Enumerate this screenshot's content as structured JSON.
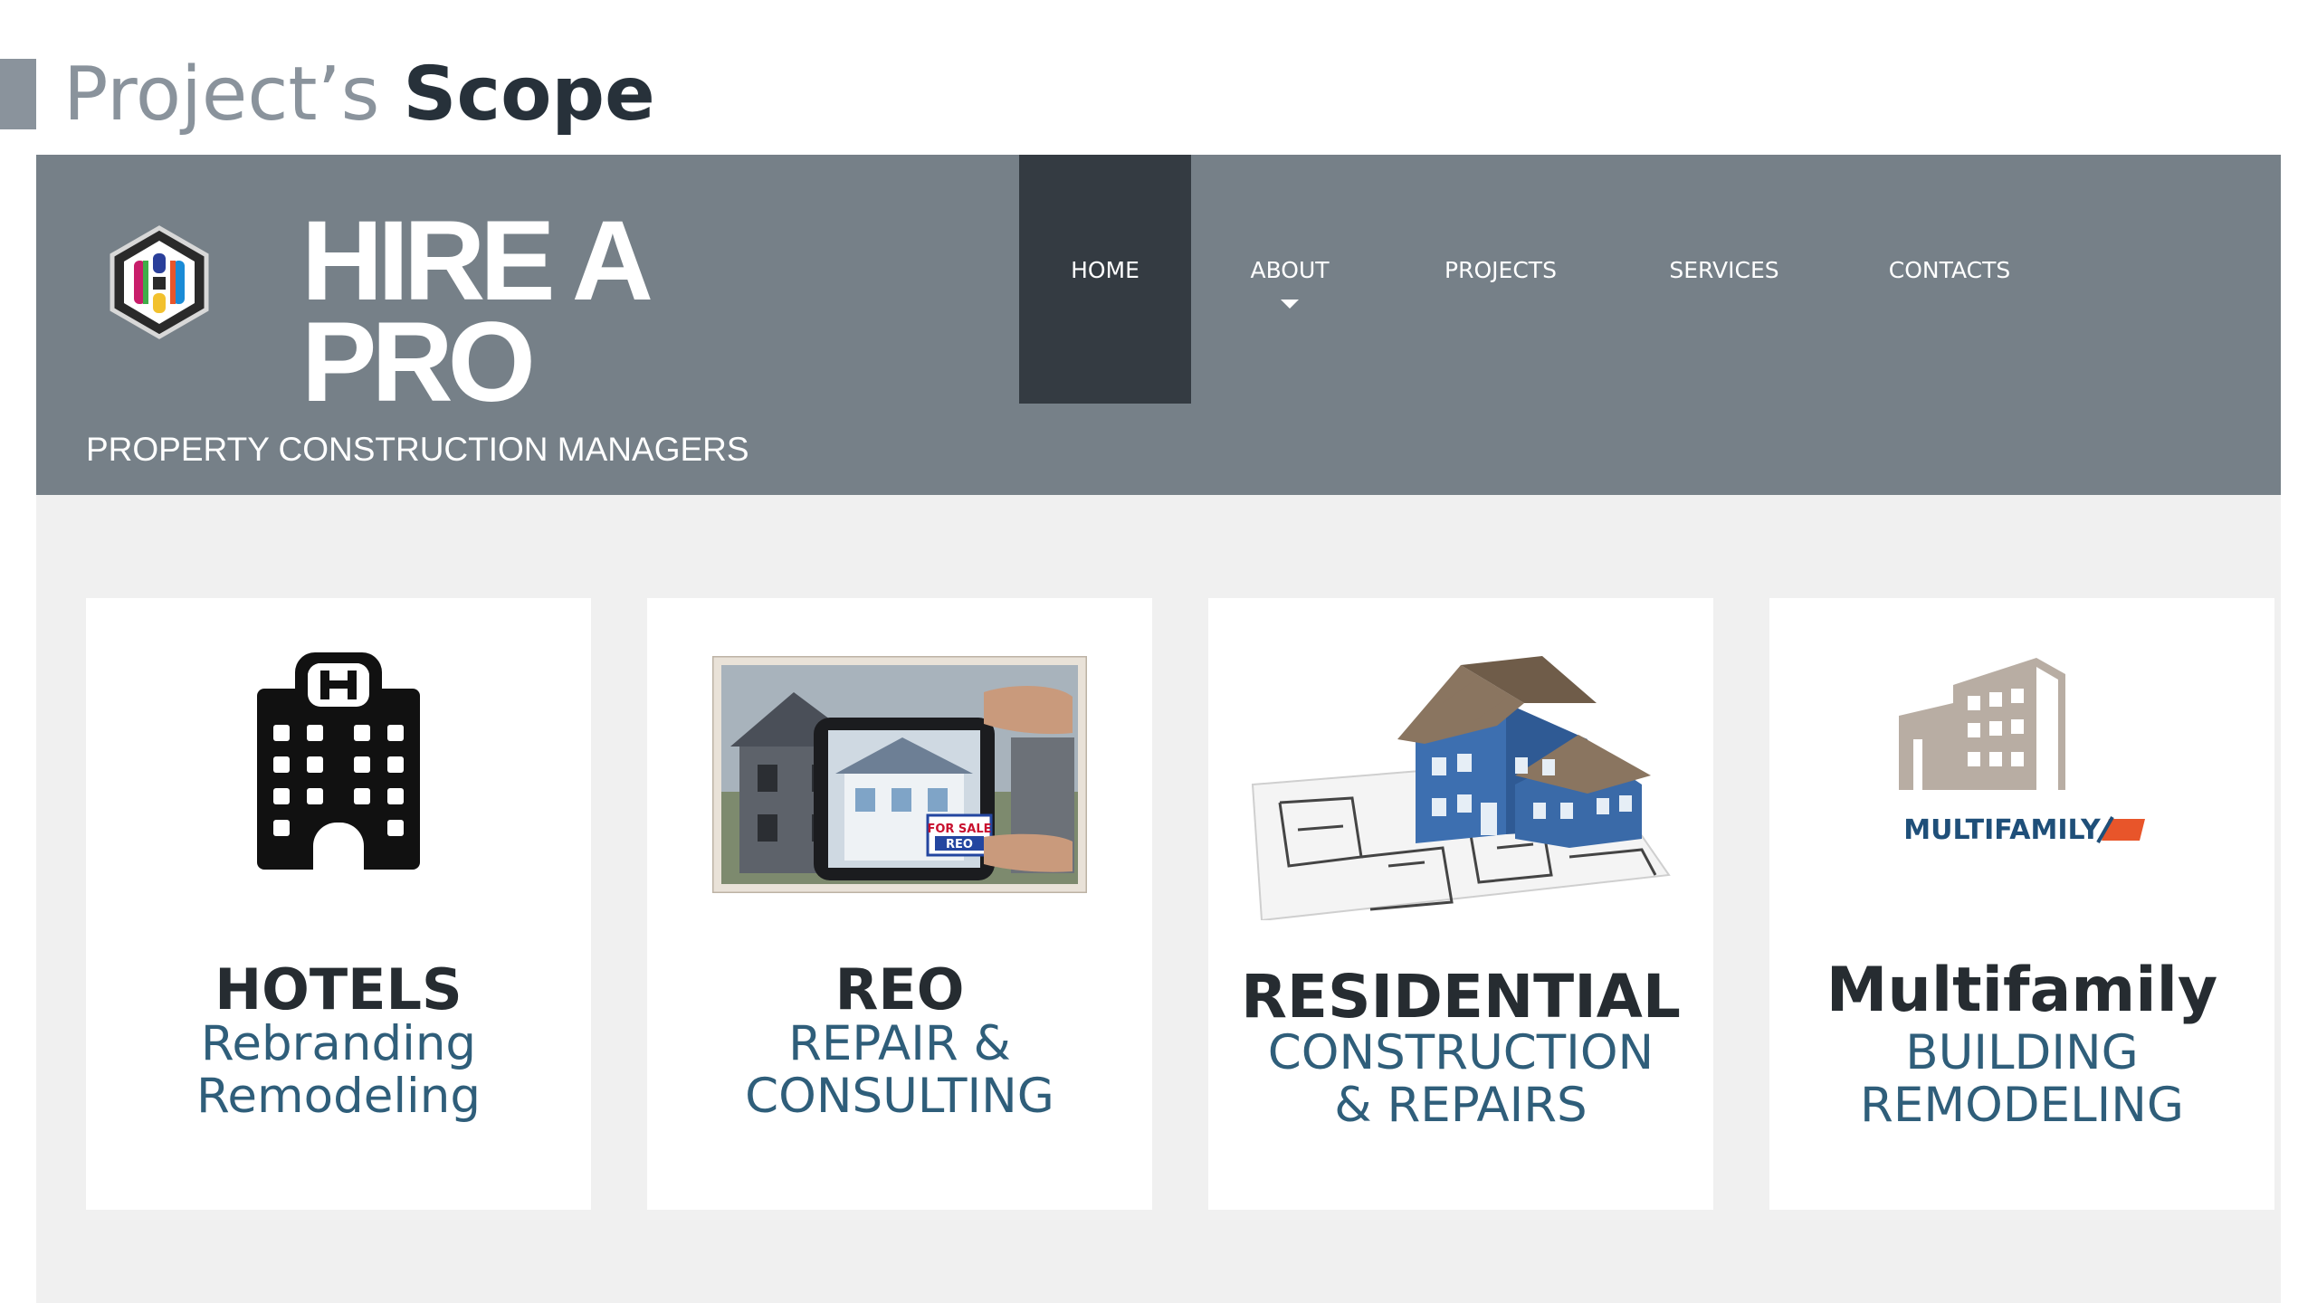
{
  "slide": {
    "title_light": "Project’s",
    "title_bold": "Scope"
  },
  "site": {
    "logo_line1": "HIRE A",
    "logo_line2": "PRO",
    "tagline": "PROPERTY CONSTRUCTION MANAGERS",
    "nav": [
      {
        "label": "HOME"
      },
      {
        "label": "ABOUT"
      },
      {
        "label": "PROJECTS"
      },
      {
        "label": "SERVICES"
      },
      {
        "label": "CONTACTS"
      }
    ]
  },
  "cards": [
    {
      "icon": "hotel-building-icon",
      "title": "HOTELS",
      "line1": "Rebranding",
      "line2": "Remodeling"
    },
    {
      "icon": "reo-phone-photo",
      "title": "REO",
      "line1": "REPAIR &",
      "line2": "CONSULTING",
      "sign_line1": "FOR SALE",
      "sign_line2": "REO"
    },
    {
      "icon": "house-blueprint-image",
      "title": "RESIDENTIAL",
      "line1": "CONSTRUCTION",
      "line2": "& REPAIRS"
    },
    {
      "icon": "multifamily-logo",
      "title": "Multifamily",
      "line1": "BUILDING",
      "line2": "REMODELING",
      "logo_text": "MULTIFAMILY"
    }
  ],
  "colors": {
    "header_bg": "#768088",
    "nav_active_bg": "#343b42",
    "page_bg": "#f0f0f0",
    "subtitle_text": "#2f5e7a",
    "title_text": "#262c31",
    "accent_orange": "#e8552a",
    "logo_blue": "#1f4f79"
  }
}
